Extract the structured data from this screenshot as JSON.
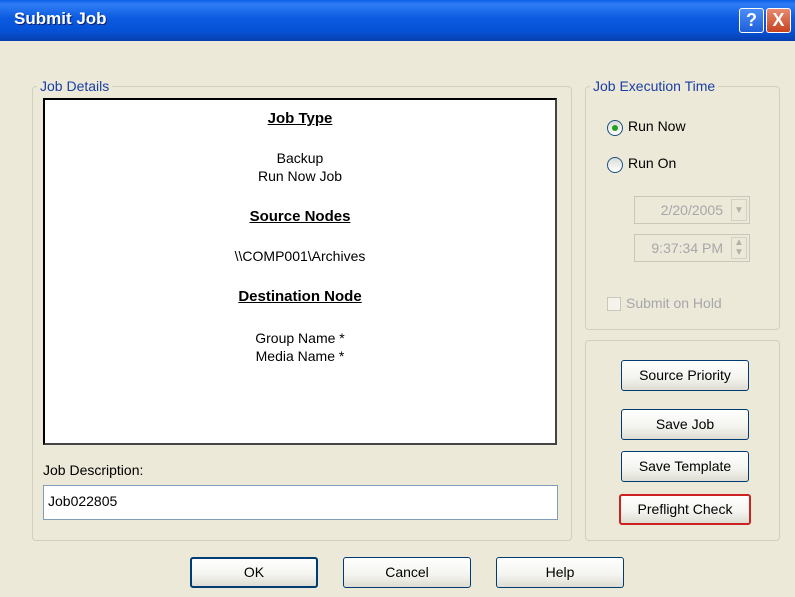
{
  "window": {
    "title": "Submit Job",
    "help_glyph": "?",
    "close_glyph": "X"
  },
  "job_details": {
    "group_label": "Job Details",
    "job_type_heading": "Job Type",
    "job_type_lines": [
      "Backup",
      "Run Now Job"
    ],
    "source_nodes_heading": "Source Nodes",
    "source_path": "\\\\COMP001\\Archives",
    "destination_heading": "Destination Node",
    "group_name": "Group Name  *",
    "media_name": "Media Name  *",
    "description_label": "Job Description:",
    "description_value": "Job022805"
  },
  "execution_time": {
    "group_label": "Job Execution Time",
    "run_now_label": "Run Now",
    "run_on_label": "Run On",
    "selected": "Run Now",
    "date_value": "2/20/2005",
    "time_value": "9:37:34 PM",
    "submit_on_hold_label": "Submit on Hold"
  },
  "actions": {
    "source_priority": "Source Priority",
    "save_job": "Save Job",
    "save_template": "Save Template",
    "preflight_check": "Preflight Check"
  },
  "footer": {
    "ok": "OK",
    "cancel": "Cancel",
    "help": "Help"
  },
  "icons": {
    "help": "question-mark-icon",
    "close": "close-icon",
    "dropdown": "chevron-down-icon",
    "spinner": "spinner-arrows-icon"
  },
  "colors": {
    "title_bar": "#0552d6",
    "group_label": "#1a3fa5",
    "preflight_border": "#cc2222",
    "radio_dot": "#21a121"
  }
}
